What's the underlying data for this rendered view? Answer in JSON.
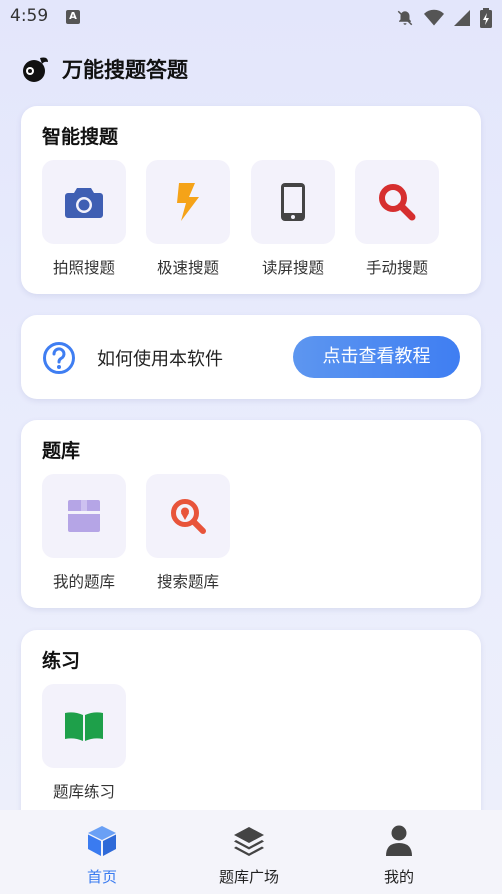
{
  "status_bar": {
    "time": "4:59",
    "notification_letter": "A"
  },
  "header": {
    "app_title": "万能搜题答题"
  },
  "smart_search": {
    "title": "智能搜题",
    "items": [
      {
        "label": "拍照搜题",
        "icon": "camera-icon",
        "color": "#3f5fb3"
      },
      {
        "label": "极速搜题",
        "icon": "lightning-icon",
        "color": "#f5a318"
      },
      {
        "label": "读屏搜题",
        "icon": "phone-icon",
        "color": "#444444"
      },
      {
        "label": "手动搜题",
        "icon": "search-icon",
        "color": "#d62f2f"
      }
    ]
  },
  "help": {
    "text": "如何使用本软件",
    "button_label": "点击查看教程",
    "icon": "question-circle-icon",
    "color": "#3f7ef2"
  },
  "question_bank": {
    "title": "题库",
    "items": [
      {
        "label": "我的题库",
        "icon": "box-icon",
        "color": "#b5a5e6"
      },
      {
        "label": "搜索题库",
        "icon": "location-search-icon",
        "color": "#e8543a"
      }
    ]
  },
  "practice": {
    "title": "练习",
    "items": [
      {
        "label": "题库练习",
        "icon": "open-book-icon",
        "color": "#1ea04a"
      }
    ]
  },
  "bottom_nav": {
    "items": [
      {
        "label": "首页",
        "icon": "cube-icon",
        "active": true
      },
      {
        "label": "题库广场",
        "icon": "layers-icon",
        "active": false
      },
      {
        "label": "我的",
        "icon": "person-icon",
        "active": false
      }
    ],
    "active_color": "#3a7bf0"
  }
}
